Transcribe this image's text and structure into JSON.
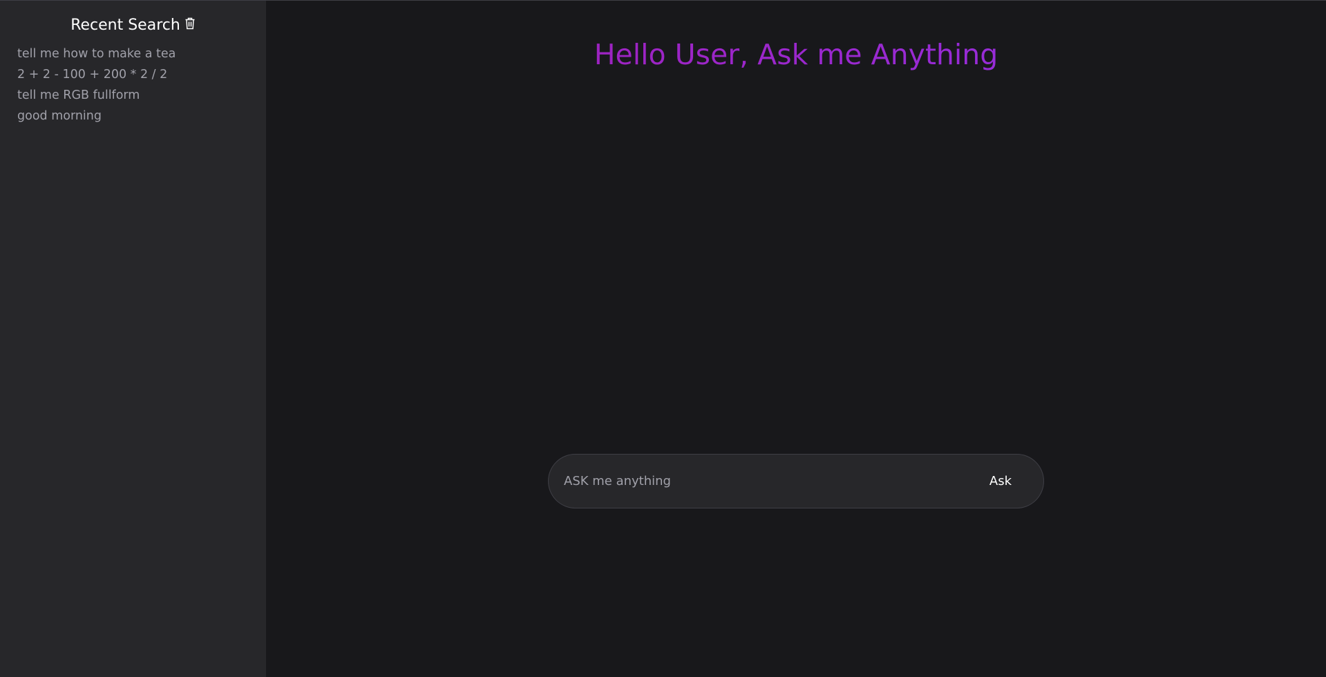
{
  "sidebar": {
    "title": "Recent Search",
    "clear_icon": "trash-icon",
    "items": [
      {
        "label": "tell me how to make a tea"
      },
      {
        "label": "2 + 2 - 100 + 200 * 2 / 2"
      },
      {
        "label": "tell me RGB fullform"
      },
      {
        "label": "good morning"
      }
    ]
  },
  "main": {
    "greeting": "Hello User, Ask me Anything",
    "input": {
      "value": "",
      "placeholder": "ASK me anything"
    },
    "ask_button_label": "Ask"
  },
  "colors": {
    "background": "#18181b",
    "sidebar_background": "#27272a",
    "greeting_gradient_start": "#a21caf",
    "greeting_gradient_end": "#9333ea",
    "muted_text": "#a1a1aa"
  }
}
